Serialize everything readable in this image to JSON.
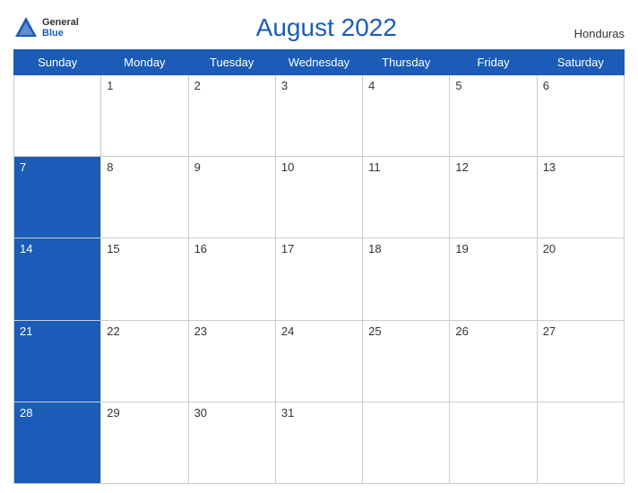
{
  "header": {
    "logo_general": "General",
    "logo_blue": "Blue",
    "title": "August 2022",
    "country": "Honduras"
  },
  "days_of_week": [
    "Sunday",
    "Monday",
    "Tuesday",
    "Wednesday",
    "Thursday",
    "Friday",
    "Saturday"
  ],
  "weeks": [
    [
      {
        "day": "",
        "blue": false,
        "empty": true
      },
      {
        "day": "1",
        "blue": false
      },
      {
        "day": "2",
        "blue": false
      },
      {
        "day": "3",
        "blue": false
      },
      {
        "day": "4",
        "blue": false
      },
      {
        "day": "5",
        "blue": false
      },
      {
        "day": "6",
        "blue": false
      }
    ],
    [
      {
        "day": "7",
        "blue": true
      },
      {
        "day": "8",
        "blue": false
      },
      {
        "day": "9",
        "blue": false
      },
      {
        "day": "10",
        "blue": false
      },
      {
        "day": "11",
        "blue": false
      },
      {
        "day": "12",
        "blue": false
      },
      {
        "day": "13",
        "blue": false
      }
    ],
    [
      {
        "day": "14",
        "blue": true
      },
      {
        "day": "15",
        "blue": false
      },
      {
        "day": "16",
        "blue": false
      },
      {
        "day": "17",
        "blue": false
      },
      {
        "day": "18",
        "blue": false
      },
      {
        "day": "19",
        "blue": false
      },
      {
        "day": "20",
        "blue": false
      }
    ],
    [
      {
        "day": "21",
        "blue": true
      },
      {
        "day": "22",
        "blue": false
      },
      {
        "day": "23",
        "blue": false
      },
      {
        "day": "24",
        "blue": false
      },
      {
        "day": "25",
        "blue": false
      },
      {
        "day": "26",
        "blue": false
      },
      {
        "day": "27",
        "blue": false
      }
    ],
    [
      {
        "day": "28",
        "blue": true
      },
      {
        "day": "29",
        "blue": false
      },
      {
        "day": "30",
        "blue": false
      },
      {
        "day": "31",
        "blue": false
      },
      {
        "day": "",
        "blue": false,
        "empty": true
      },
      {
        "day": "",
        "blue": false,
        "empty": true
      },
      {
        "day": "",
        "blue": false,
        "empty": true
      }
    ]
  ]
}
